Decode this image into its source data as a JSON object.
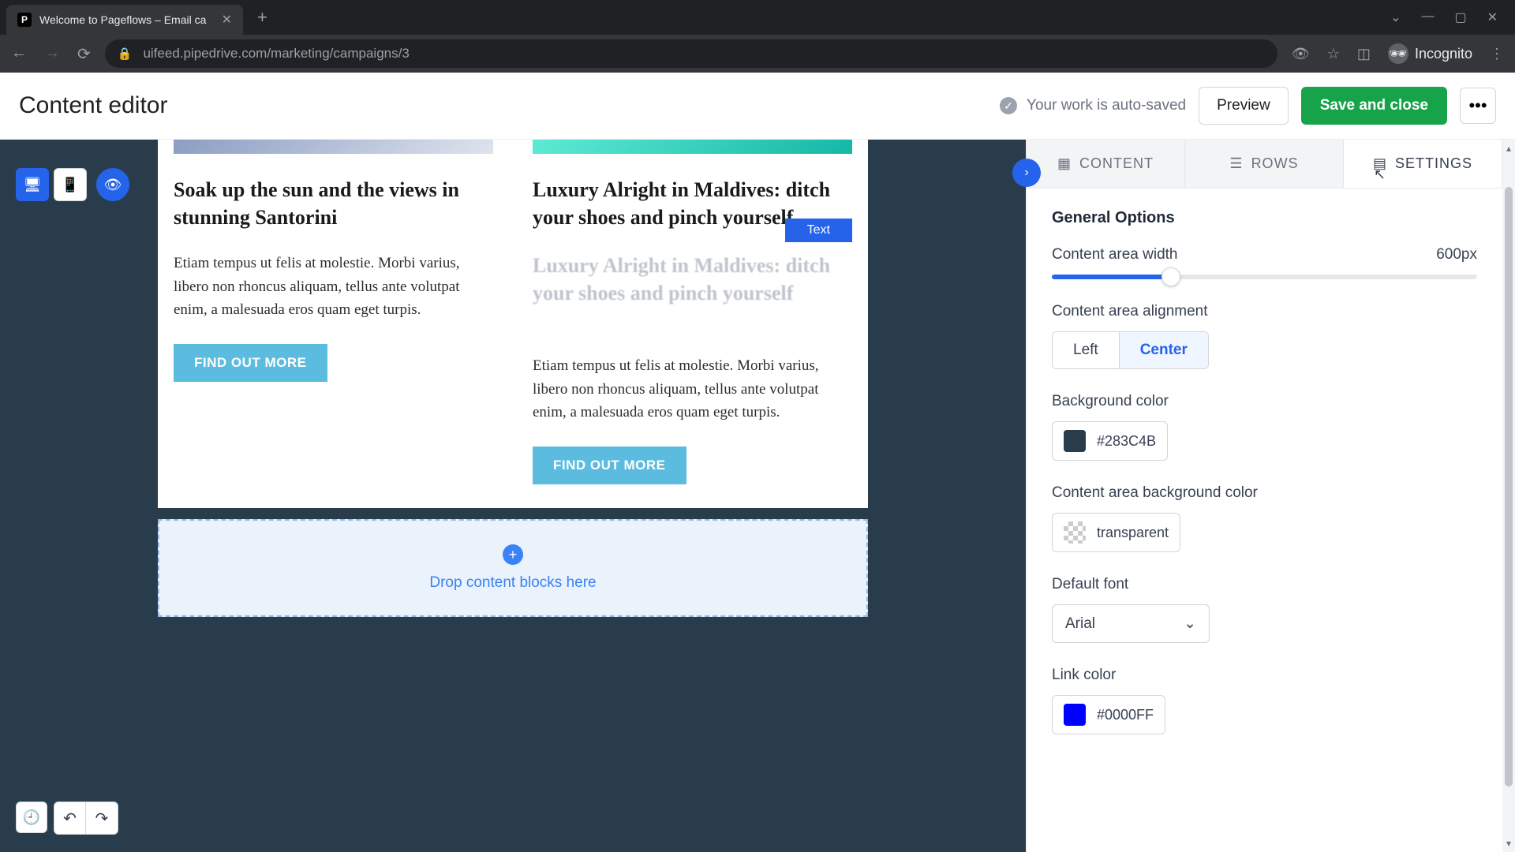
{
  "browser": {
    "tab_title": "Welcome to Pageflows – Email ca",
    "url": "uifeed.pipedrive.com/marketing/campaigns/3",
    "incognito_label": "Incognito"
  },
  "header": {
    "title": "Content editor",
    "autosave": "Your work is auto-saved",
    "preview": "Preview",
    "save": "Save and close"
  },
  "canvas": {
    "col1": {
      "heading": "Soak up the sun and the views in stunning Santorini",
      "body": "Etiam tempus ut felis at molestie. Morbi varius, libero non rhoncus aliquam, tellus ante volutpat enim, a malesuada eros quam eget turpis.",
      "cta": "FIND OUT MORE"
    },
    "col2": {
      "heading": "Luxury Alright in Maldives: ditch your shoes and pinch yourself",
      "ghost_label": "Text",
      "ghost_heading": "Luxury Alright in Maldives: ditch your shoes and pinch yourself",
      "body": "Etiam tempus ut felis at molestie. Morbi varius, libero non rhoncus aliquam, tellus ante volutpat enim, a malesuada eros quam eget turpis.",
      "cta": "FIND OUT MORE"
    },
    "dropzone": "Drop content blocks here"
  },
  "panel": {
    "tabs": {
      "content": "CONTENT",
      "rows": "ROWS",
      "settings": "SETTINGS"
    },
    "section": "General Options",
    "width": {
      "label": "Content area width",
      "value": "600px"
    },
    "alignment": {
      "label": "Content area alignment",
      "left": "Left",
      "center": "Center"
    },
    "bgcolor": {
      "label": "Background color",
      "value": "#283C4B"
    },
    "areabg": {
      "label": "Content area background color",
      "value": "transparent"
    },
    "font": {
      "label": "Default font",
      "value": "Arial"
    },
    "linkcolor": {
      "label": "Link color",
      "value": "#0000FF"
    }
  }
}
